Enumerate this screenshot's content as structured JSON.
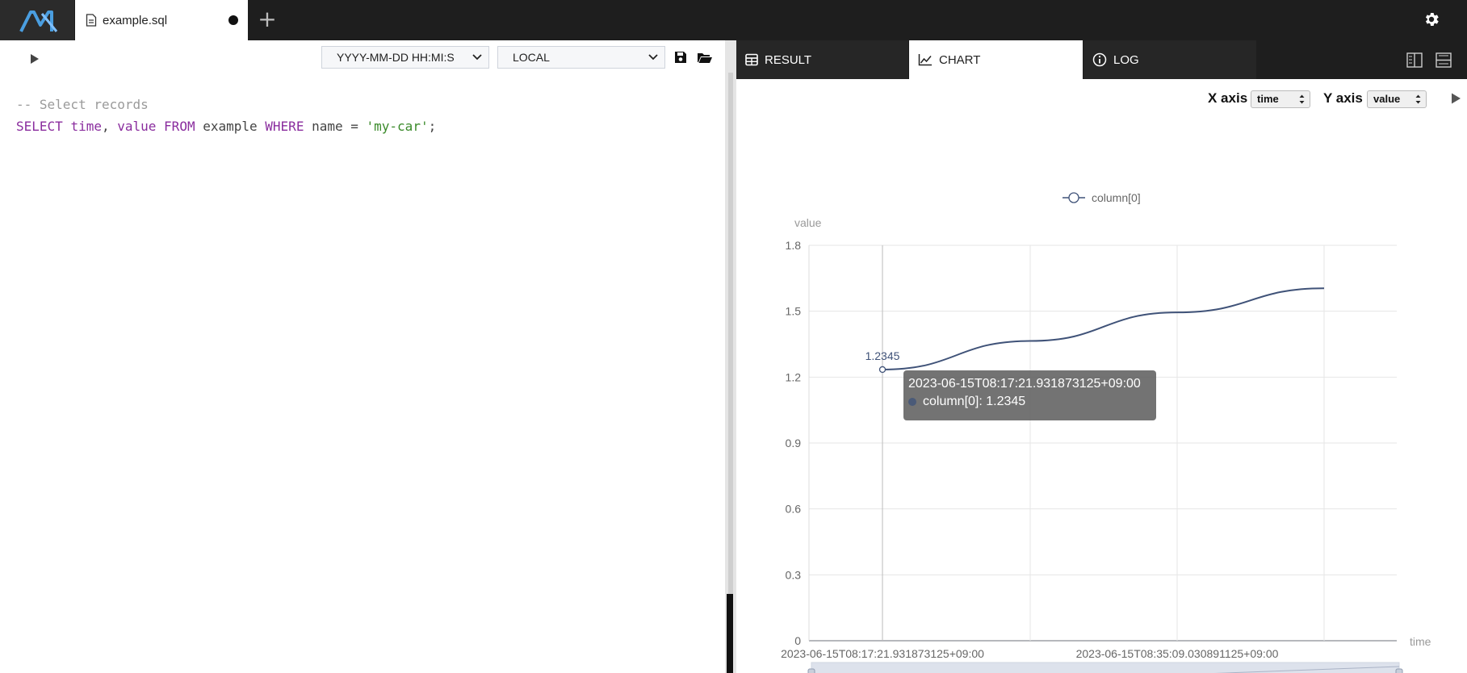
{
  "app": {
    "tab_filename": "example.sql",
    "add_tab_symbol": "+"
  },
  "editor": {
    "time_format": "YYYY-MM-DD HH:MI:S",
    "timezone": "LOCAL",
    "code": {
      "comment": "-- Select records",
      "line2": [
        {
          "t": "SELECT",
          "c": "kw"
        },
        {
          "t": " ",
          "c": "id"
        },
        {
          "t": "time",
          "c": "kw"
        },
        {
          "t": ", ",
          "c": "id"
        },
        {
          "t": "value",
          "c": "kw"
        },
        {
          "t": " ",
          "c": "id"
        },
        {
          "t": "FROM",
          "c": "kw"
        },
        {
          "t": " example ",
          "c": "id"
        },
        {
          "t": "WHERE",
          "c": "kw"
        },
        {
          "t": " name = ",
          "c": "id"
        },
        {
          "t": "'my-car'",
          "c": "str"
        },
        {
          "t": ";",
          "c": "id"
        }
      ]
    }
  },
  "result_tabs": {
    "result": "RESULT",
    "chart": "CHART",
    "log": "LOG"
  },
  "chart_controls": {
    "x_axis_label": "X axis",
    "x_axis_value": "time",
    "y_axis_label": "Y axis",
    "y_axis_value": "value"
  },
  "tooltip": {
    "time": "2023-06-15T08:17:21.931873125+09:00",
    "entry": "column[0]: 1.2345"
  },
  "colors": {
    "line": "#3f5278",
    "grid": "#e6e6e6",
    "axis_text": "#666666"
  },
  "chart_data": {
    "type": "line",
    "legend": [
      "column[0]"
    ],
    "legend_position": "top-center",
    "xlabel": "time",
    "ylabel": "value",
    "ylim": [
      0,
      1.8
    ],
    "yticks": [
      "0",
      "0.3",
      "0.6",
      "0.9",
      "1.2",
      "1.5",
      "1.8"
    ],
    "xtick_labels": [
      "2023-06-15T08:17:21.931873125+09:00",
      "2023-06-15T08:35:09.030891125+09:00"
    ],
    "grid": true,
    "series": [
      {
        "name": "column[0]",
        "x_index": [
          0,
          1,
          2,
          3
        ],
        "values": [
          1.2345,
          1.3645,
          1.4945,
          1.6045
        ]
      }
    ],
    "data_label": "1.2345"
  }
}
